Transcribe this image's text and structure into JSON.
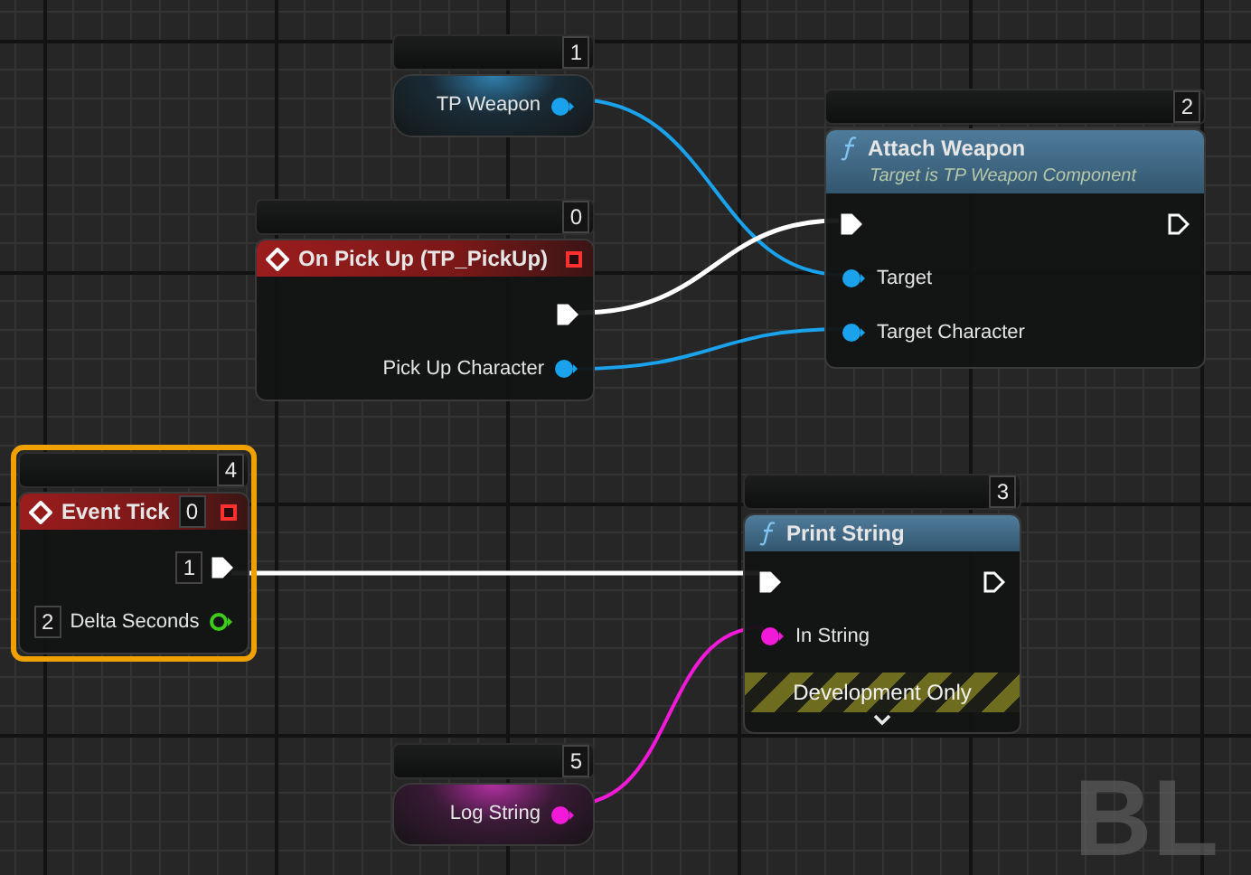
{
  "nodes": [
    {
      "kind": "variable",
      "badge": "1",
      "selected": false,
      "pins": [
        {
          "label": "TP Weapon",
          "kind": "object",
          "output": true,
          "connected": true
        }
      ]
    },
    {
      "kind": "function",
      "badge": "2",
      "selected": false,
      "title": "Attach Weapon",
      "subtitle": "Target is TP Weapon Component",
      "pins": [
        {
          "kind": "exec",
          "output": false,
          "connected": true
        },
        {
          "kind": "exec",
          "output": true,
          "connected": false
        },
        {
          "label": "Target",
          "kind": "object",
          "output": false,
          "connected": true
        },
        {
          "label": "Target Character",
          "kind": "object",
          "output": false,
          "connected": true
        }
      ]
    },
    {
      "kind": "event",
      "badge": "0",
      "selected": false,
      "title": "On Pick Up (TP_PickUp)",
      "pins": [
        {
          "kind": "exec",
          "output": true,
          "connected": true
        },
        {
          "label": "Pick Up Character",
          "kind": "object",
          "output": true,
          "connected": true
        }
      ]
    },
    {
      "kind": "event",
      "badge": "4",
      "selected": true,
      "title": "Event Tick",
      "title_badge": "0",
      "pins": [
        {
          "kind": "exec",
          "output": true,
          "connected": true,
          "badge": "1"
        },
        {
          "label": "Delta Seconds",
          "kind": "float",
          "output": true,
          "connected": false,
          "badge": "2"
        }
      ]
    },
    {
      "kind": "function",
      "badge": "3",
      "selected": false,
      "title": "Print String",
      "footer": "Development Only",
      "pins": [
        {
          "kind": "exec",
          "output": false,
          "connected": true
        },
        {
          "kind": "exec",
          "output": true,
          "connected": false
        },
        {
          "label": "In String",
          "kind": "string",
          "output": false,
          "connected": true
        }
      ]
    },
    {
      "kind": "variable",
      "badge": "5",
      "selected": false,
      "pins": [
        {
          "label": "Log String",
          "kind": "string",
          "output": true,
          "connected": true
        }
      ]
    }
  ],
  "graph_label": "BL"
}
